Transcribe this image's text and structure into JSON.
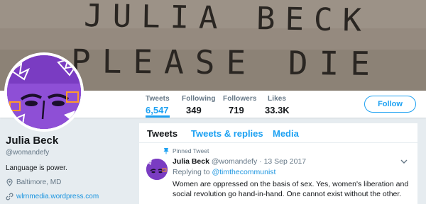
{
  "banner": {
    "graffiti_line1": "JULIA BECK",
    "graffiti_line2": "PLEASE DIE"
  },
  "stats": [
    {
      "label": "Tweets",
      "value": "6,547"
    },
    {
      "label": "Following",
      "value": "349"
    },
    {
      "label": "Followers",
      "value": "719"
    },
    {
      "label": "Likes",
      "value": "33.3K"
    }
  ],
  "follow_label": "Follow",
  "profile": {
    "name": "Julia Beck",
    "handle": "@womandefy",
    "bio": "Language is power.",
    "location": "Baltimore, MD",
    "website": "wlrnmedia.wordpress.com"
  },
  "tabs": [
    {
      "label": "Tweets"
    },
    {
      "label": "Tweets & replies"
    },
    {
      "label": "Media"
    }
  ],
  "tweet": {
    "pinned_label": "Pinned Tweet",
    "name": "Julia Beck",
    "handle": "@womandefy",
    "separator": "·",
    "date": "13 Sep 2017",
    "replying_prefix": "Replying to",
    "replying_user": "@timthecommunist",
    "text": "Women are oppressed on the basis of sex. Yes, women's liberation and social revolution go hand-in-hand. One cannot exist without the other."
  },
  "colors": {
    "accent": "#1da1f2",
    "avatar_purple": "#7a3cc2"
  },
  "icons": [
    "pin-icon",
    "location-icon",
    "link-icon",
    "chevron-down-icon"
  ]
}
